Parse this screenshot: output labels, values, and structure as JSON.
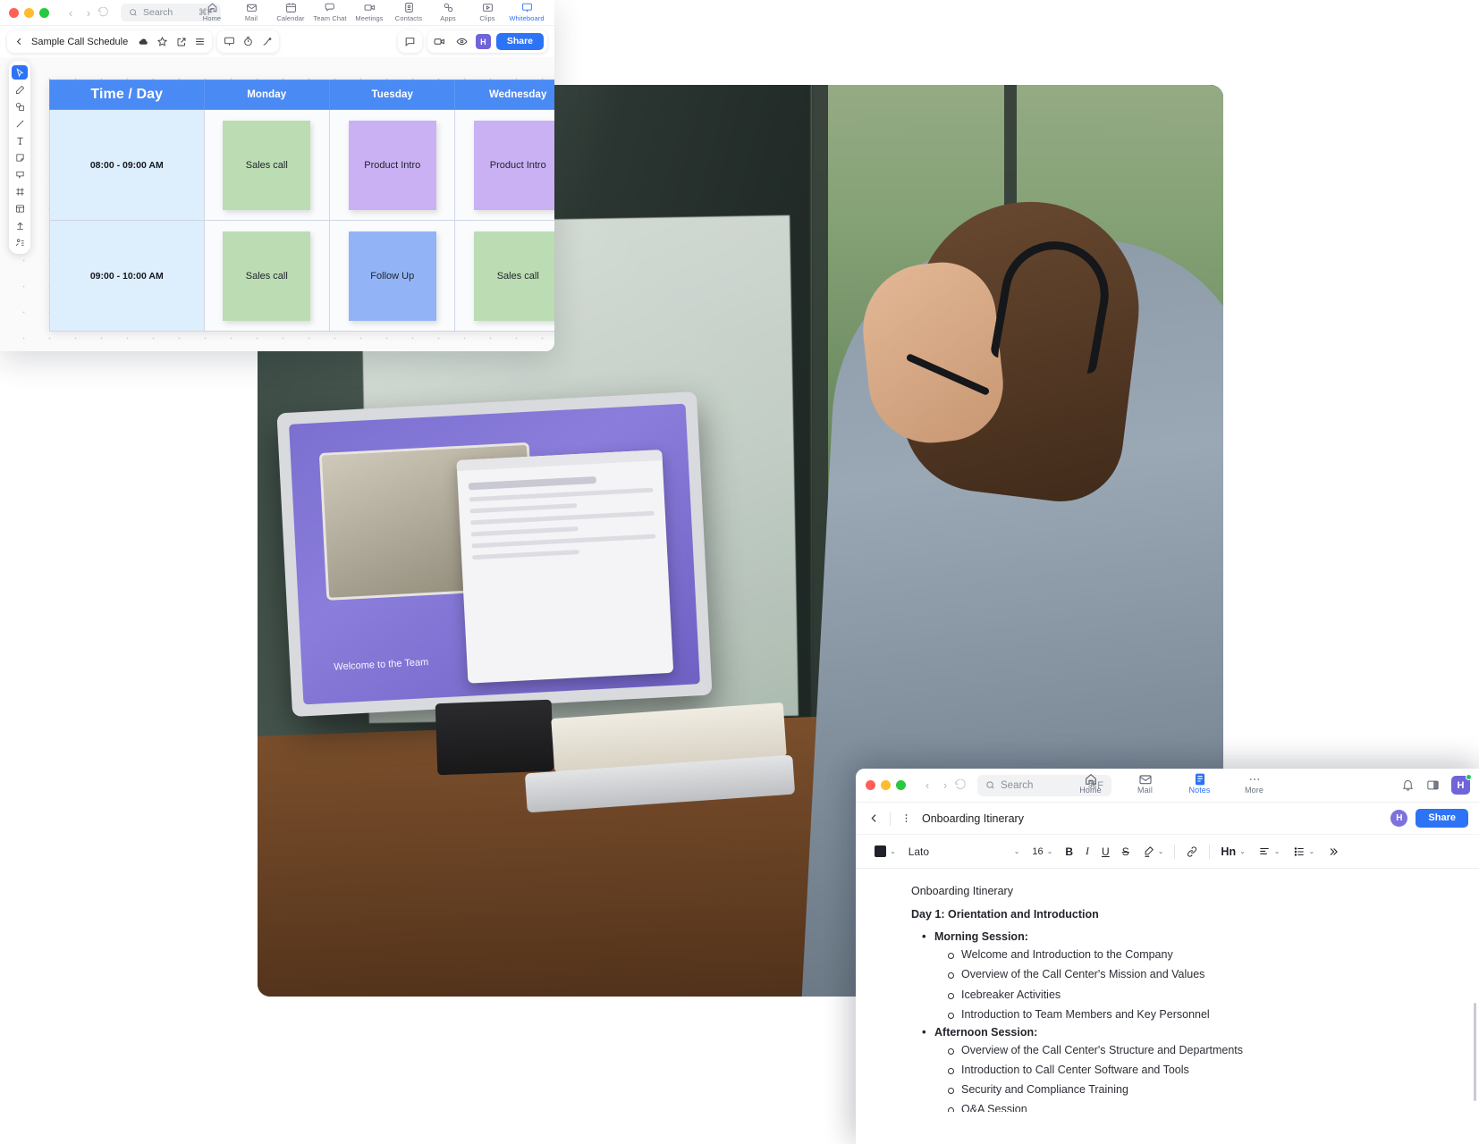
{
  "whiteboard_window": {
    "titlebar": {
      "traffic_lights": [
        "close",
        "minimize",
        "maximize"
      ],
      "back_label": "‹",
      "forward_label": "›",
      "history_icon": "history-icon",
      "search": {
        "icon": "search-icon",
        "placeholder": "Search",
        "shortcut": "⌘F"
      }
    },
    "nav_tabs": [
      {
        "label": "Home",
        "icon": "home-icon",
        "active": false
      },
      {
        "label": "Mail",
        "icon": "mail-icon",
        "active": false
      },
      {
        "label": "Calendar",
        "icon": "calendar-icon",
        "active": false
      },
      {
        "label": "Team Chat",
        "icon": "chat-icon",
        "active": false
      },
      {
        "label": "Meetings",
        "icon": "video-icon",
        "active": false
      },
      {
        "label": "Contacts",
        "icon": "contacts-icon",
        "active": false
      },
      {
        "label": "Apps",
        "icon": "apps-icon",
        "active": false
      },
      {
        "label": "Clips",
        "icon": "clips-icon",
        "active": false
      },
      {
        "label": "Whiteboard",
        "icon": "whiteboard-icon",
        "active": true
      }
    ],
    "toolbar": {
      "back_icon": "chevron-left-icon",
      "doc_name": "Sample Call Schedule",
      "cloud_icon": "cloud-save-icon",
      "star_icon": "star-icon",
      "export_icon": "export-icon",
      "menu_icon": "hamburger-menu-icon",
      "present_icon": "present-icon",
      "timer_icon": "timer-icon",
      "laser_icon": "laser-pointer-icon",
      "comment_icon": "comment-icon",
      "video_icon": "video-camera-icon",
      "follow_icon": "follow-eye-icon",
      "avatar_initial": "H",
      "share_label": "Share"
    },
    "tools": [
      {
        "name": "select-tool",
        "icon": "cursor-icon",
        "selected": true
      },
      {
        "name": "pen-tool",
        "icon": "pen-icon",
        "selected": false
      },
      {
        "name": "shapes-tool",
        "icon": "shapes-icon",
        "selected": false
      },
      {
        "name": "line-tool",
        "icon": "line-icon",
        "selected": false
      },
      {
        "name": "text-tool",
        "icon": "text-icon",
        "selected": false
      },
      {
        "name": "sticky-note-tool",
        "icon": "sticky-note-icon",
        "selected": false
      },
      {
        "name": "comment-tool",
        "icon": "comment-bubble-icon",
        "selected": false
      },
      {
        "name": "frame-tool",
        "icon": "frame-icon",
        "selected": false
      },
      {
        "name": "template-tool",
        "icon": "template-icon",
        "selected": false
      },
      {
        "name": "upload-tool",
        "icon": "upload-icon",
        "selected": false
      },
      {
        "name": "more-tool",
        "icon": "more-tools-icon",
        "selected": false
      }
    ],
    "schedule_table": {
      "headers": [
        "Time / Day",
        "Monday",
        "Tuesday",
        "Wednesday"
      ],
      "rows": [
        {
          "time": "08:00 - 09:00 AM",
          "cells": [
            {
              "text": "Sales call",
              "color": "green"
            },
            {
              "text": "Product Intro",
              "color": "purple"
            },
            {
              "text": "Product Intro",
              "color": "purple"
            }
          ]
        },
        {
          "time": "09:00 - 10:00 AM",
          "cells": [
            {
              "text": "Sales call",
              "color": "green"
            },
            {
              "text": "Follow Up",
              "color": "blue"
            },
            {
              "text": "Sales call",
              "color": "green"
            }
          ]
        }
      ],
      "colors": {
        "green": "#bcdcb4",
        "purple": "#c9b1f4",
        "blue": "#92b4f7",
        "header": "#4a8af4",
        "time_cell": "#ddeefc"
      }
    }
  },
  "notes_window": {
    "titlebar": {
      "search": {
        "placeholder": "Search",
        "shortcut": "⌘F"
      }
    },
    "nav_tabs": [
      {
        "label": "Home",
        "icon": "home-icon",
        "active": false
      },
      {
        "label": "Mail",
        "icon": "mail-icon",
        "active": false
      },
      {
        "label": "Notes",
        "icon": "notes-icon",
        "active": true
      },
      {
        "label": "More",
        "icon": "ellipsis-icon",
        "active": false
      }
    ],
    "right_icons": {
      "bell": "bell-icon",
      "panel": "side-panel-icon",
      "avatar_initial": "H"
    },
    "doc_bar": {
      "back_icon": "chevron-left-icon",
      "kebab_icon": "kebab-menu-icon",
      "title": "Onboarding Itinerary",
      "avatar_initial": "H",
      "share_label": "Share"
    },
    "format_toolbar": {
      "text_color": "#1f2329",
      "font_family": "Lato",
      "font_size": "16",
      "bold": "B",
      "italic": "I",
      "underline": "U",
      "strikethrough": "S",
      "highlight_icon": "highlighter-icon",
      "link_icon": "link-icon",
      "heading_label": "Hn",
      "align_icon": "align-left-icon",
      "list_icon": "bullet-list-icon",
      "overflow_icon": "chevron-double-right-icon"
    },
    "document": {
      "title_line": "Onboarding Itinerary",
      "day_heading": "Day 1: Orientation and Introduction",
      "sections": [
        {
          "heading": "Morning Session:",
          "items": [
            "Welcome and Introduction to the Company",
            "Overview of the Call Center's Mission and Values",
            "Icebreaker Activities",
            "Introduction to Team Members and Key Personnel"
          ]
        },
        {
          "heading": "Afternoon Session:",
          "items": [
            "Overview of the Call Center's Structure and Departments",
            "Introduction to Call Center Software and Tools",
            "Security and Compliance Training",
            "Q&A Session"
          ]
        }
      ]
    }
  },
  "accent_colors": {
    "primary_blue": "#2d73f5",
    "avatar_purple": "#6f64d8",
    "online_green": "#22c55e"
  }
}
